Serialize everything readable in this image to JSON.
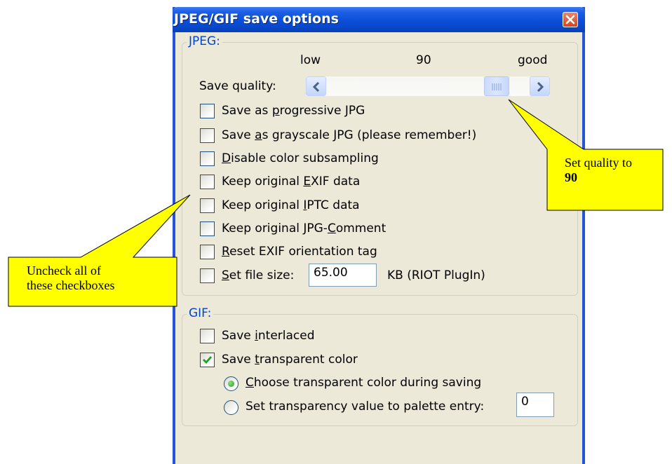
{
  "window": {
    "title": "JPEG/GIF save options",
    "close_icon": "close-icon"
  },
  "jpeg": {
    "legend": "JPEG:",
    "slider": {
      "low_label": "low",
      "value_label": "90",
      "good_label": "good",
      "label": "Save quality:",
      "value": 90
    },
    "options": [
      {
        "pre": "Save as ",
        "u": "p",
        "post": "rogressive JPG",
        "checked": false
      },
      {
        "pre": "Save ",
        "u": "a",
        "post": "s grayscale JPG (please remember!)",
        "checked": false
      },
      {
        "pre": "",
        "u": "D",
        "post": "isable color subsampling",
        "checked": false
      },
      {
        "pre": "Keep original ",
        "u": "E",
        "post": "XIF data",
        "checked": false
      },
      {
        "pre": "Keep original ",
        "u": "I",
        "post": "PTC data",
        "checked": false
      },
      {
        "pre": "Keep original JPG-",
        "u": "C",
        "post": "omment",
        "checked": false
      },
      {
        "pre": "",
        "u": "R",
        "post": "eset EXIF orientation tag",
        "checked": false
      }
    ],
    "file_size": {
      "u": "S",
      "label": "et file size:",
      "value": "65.00",
      "unit": "KB (RIOT PlugIn)",
      "checked": false
    }
  },
  "gif": {
    "legend": "GIF:",
    "interlaced": {
      "pre": "Save ",
      "u": "i",
      "post": "nterlaced",
      "checked": false
    },
    "transparent": {
      "pre": "Save ",
      "u": "t",
      "post": "ransparent color",
      "checked": true
    },
    "radio_choose": {
      "u": "C",
      "post": "hoose transparent color during saving",
      "selected": true
    },
    "radio_palette": {
      "label": "Set transparency value to palette entry:",
      "value": "0",
      "selected": false
    }
  },
  "callouts": {
    "quality": {
      "line1": "Set quality to",
      "line2": "90"
    },
    "uncheck": {
      "line1": "Uncheck all of",
      "line2": "these checkboxes"
    }
  },
  "colors": {
    "callout_fill": "#ffff00",
    "title_bar": "#0a4fd8",
    "legend_text": "#0046d5",
    "dialog_bg": "#ece9d8"
  }
}
